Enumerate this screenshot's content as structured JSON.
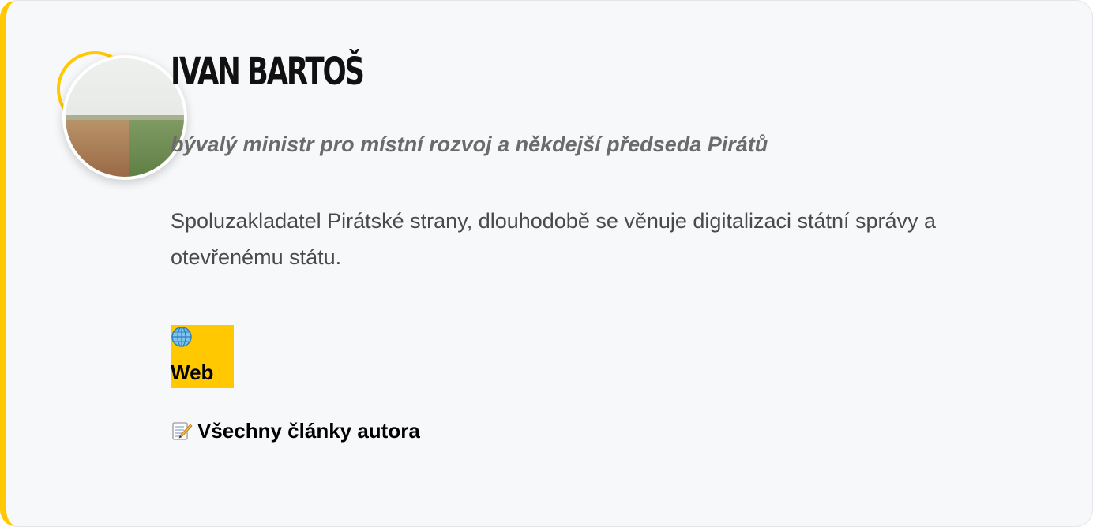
{
  "author": {
    "name": "IVAN BARTOŠ",
    "role": "bývalý ministr pro místní rozvoj a někdejší předseda Pirátů",
    "bio": "Spoluzakladatel Pirátské strany, dlouhodobě se věnuje digitalizaci státní správy a otevřenému státu.",
    "avatar_icon": "author-photo"
  },
  "links": {
    "web": {
      "icon": "globe-icon",
      "label": "Web"
    },
    "articles": {
      "icon": "memo-icon",
      "label": "Všechny články autora"
    }
  },
  "colors": {
    "accent": "#ffc800",
    "card_background": "#f7f8fa",
    "name_text": "#111111",
    "role_text": "#6b6b6b",
    "bio_text": "#4a4a4a"
  }
}
